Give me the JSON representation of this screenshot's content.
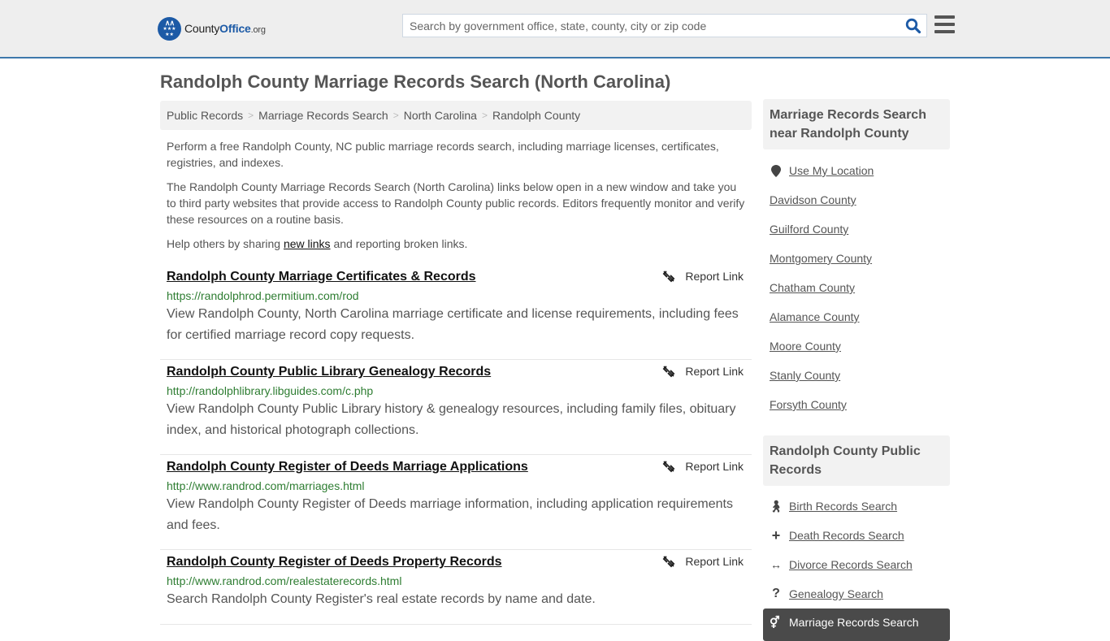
{
  "header": {
    "logo": {
      "name_part1": "County",
      "name_part2": "Office",
      "name_part3": ".org"
    },
    "search": {
      "placeholder": "Search by government office, state, county, city or zip code",
      "value": ""
    },
    "brand_color": "#1c5aa6",
    "accent_border": "#3e78ab"
  },
  "page": {
    "title": "Randolph County Marriage Records Search (North Carolina)"
  },
  "breadcrumb": [
    {
      "label": "Public Records"
    },
    {
      "label": "Marriage Records Search"
    },
    {
      "label": "North Carolina"
    },
    {
      "label": "Randolph County"
    }
  ],
  "intro": {
    "p1": "Perform a free Randolph County, NC public marriage records search, including marriage licenses, certificates, registries, and indexes.",
    "p2": "The Randolph County Marriage Records Search (North Carolina) links below open in a new window and take you to third party websites that provide access to Randolph County public records. Editors frequently monitor and verify these resources on a routine basis.",
    "p3_before": "Help others by sharing ",
    "p3_link": "new links",
    "p3_after": " and reporting broken links."
  },
  "report_label": "Report Link",
  "results": [
    {
      "title": "Randolph County Marriage Certificates & Records",
      "url": "https://randolphrod.permitium.com/rod",
      "description": "View Randolph County, North Carolina marriage certificate and license requirements, including fees for certified marriage record copy requests."
    },
    {
      "title": "Randolph County Public Library Genealogy Records",
      "url": "http://randolphlibrary.libguides.com/c.php",
      "description": "View Randolph County Public Library history & genealogy resources, including family files, obituary index, and historical photograph collections."
    },
    {
      "title": "Randolph County Register of Deeds Marriage Applications",
      "url": "http://www.randrod.com/marriages.html",
      "description": "View Randolph County Register of Deeds marriage information, including application requirements and fees."
    },
    {
      "title": "Randolph County Register of Deeds Property Records",
      "url": "http://www.randrod.com/realestaterecords.html",
      "description": "Search Randolph County Register's real estate records by name and date."
    }
  ],
  "sidebar": {
    "nearby": {
      "heading": "Marriage Records Search near Randolph County",
      "use_location": "Use My Location",
      "counties": [
        "Davidson County",
        "Guilford County",
        "Montgomery County",
        "Chatham County",
        "Alamance County",
        "Moore County",
        "Stanly County",
        "Forsyth County"
      ]
    },
    "public_records": {
      "heading": "Randolph County Public Records",
      "items": [
        {
          "label": "Birth Records Search",
          "icon": "child-icon"
        },
        {
          "label": "Death Records Search",
          "icon": "plus-icon"
        },
        {
          "label": "Divorce Records Search",
          "icon": "arrows-horizontal-icon"
        },
        {
          "label": "Genealogy Search",
          "icon": "question-icon"
        }
      ],
      "active": {
        "label": "Marriage Records Search",
        "icon": "marriage-icon"
      }
    }
  }
}
